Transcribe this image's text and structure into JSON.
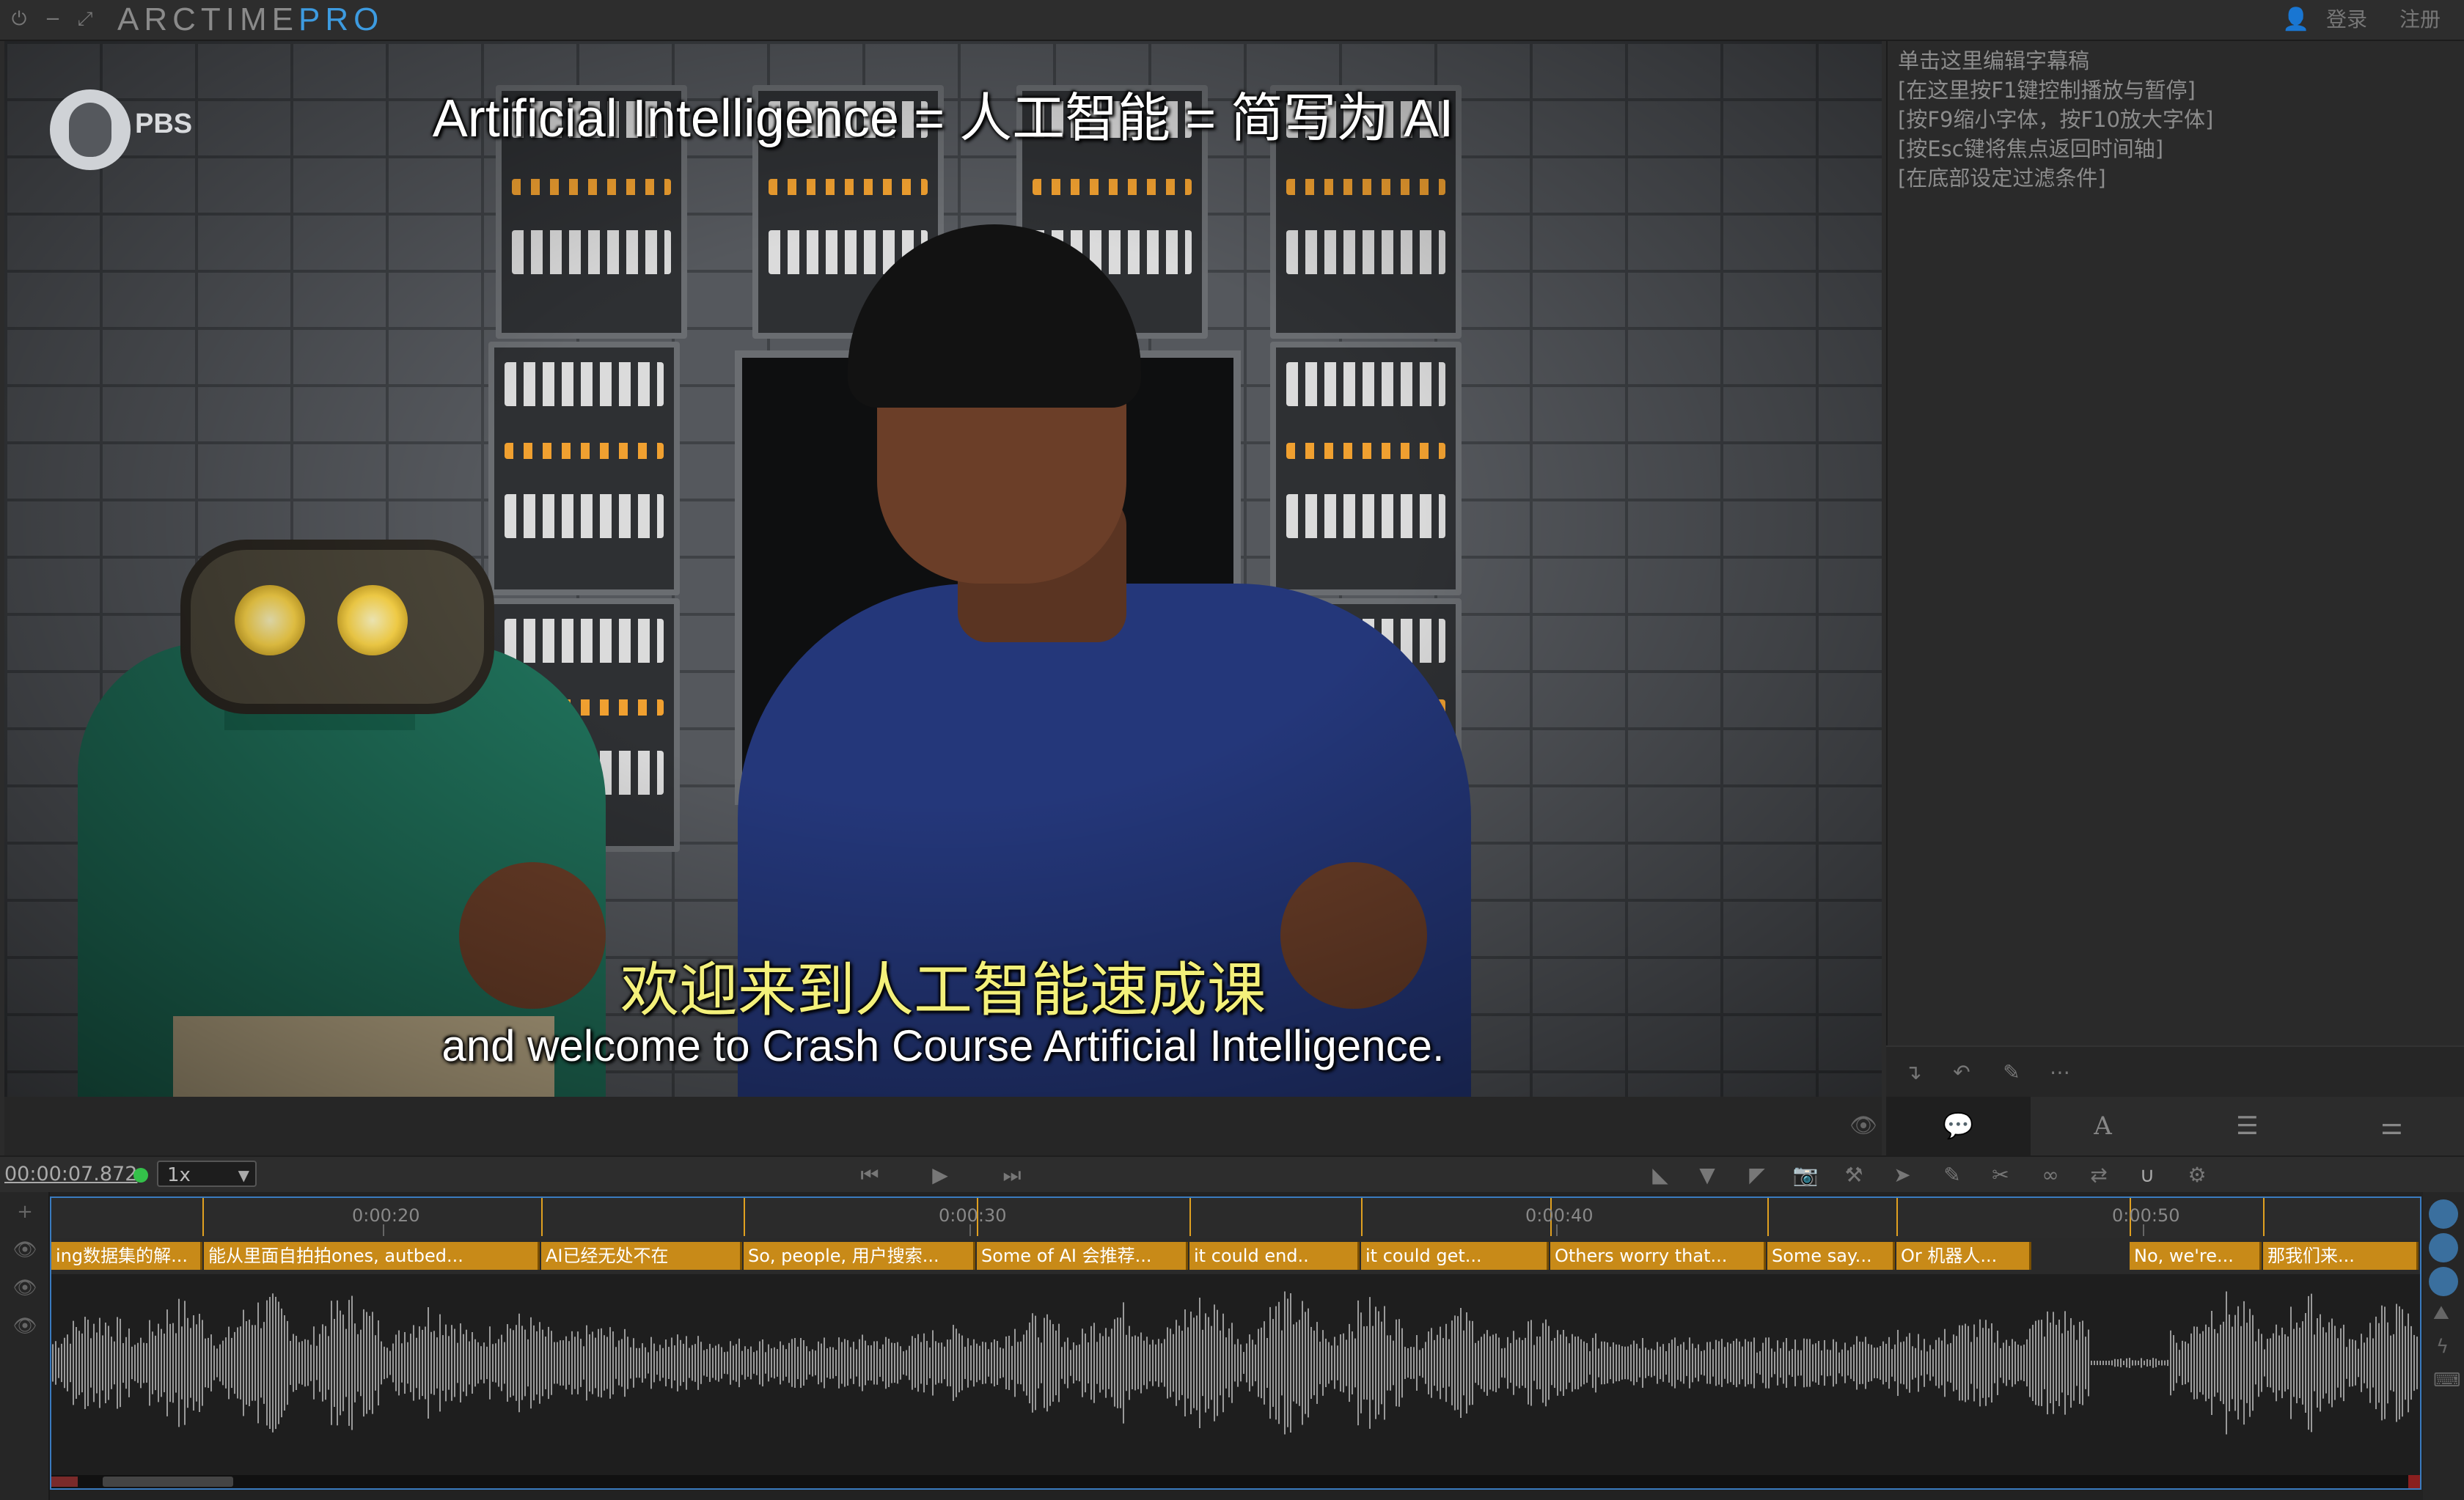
{
  "titlebar": {
    "app_name": "ARCTIME",
    "app_edition": "PRO",
    "login": "登录",
    "register": "注册"
  },
  "video": {
    "subtitle_top": "Artificial Intelligence = 人工智能 = 简写为 AI",
    "subtitle_cn": "欢迎来到人工智能速成课",
    "subtitle_en": "and welcome to Crash Course Artificial Intelligence.",
    "logo_text": "PBS"
  },
  "editor_hints": [
    "单击这里编辑字幕稿",
    "[在这里按F1键控制播放与暂停]",
    "[按F9缩小字体，按F10放大字体]",
    "[按Esc键将焦点返回时间轴]",
    "[在底部设定过滤条件]"
  ],
  "transport": {
    "timecode": "00:00:07.872",
    "speed": "1x"
  },
  "timeline": {
    "ruler_labels": [
      "0:00:20",
      "0:00:30",
      "0:00:40",
      "0:00:50"
    ],
    "segments": [
      "ing数据集的解...",
      "能从里面自拍拍ones, autbed...",
      "AI已经无处不在",
      "So, people, 用户搜索...",
      "Some of AI 会推荐...",
      "it could end..",
      "it could get...",
      "Others worry that...",
      "Some say...",
      "Or 机器人...",
      "No, we're...",
      "那我们来..."
    ]
  },
  "colors": {
    "accent": "#3d9be0",
    "segment": "#c88a18",
    "timeline_border": "#3a7bbf",
    "status_green": "#34c04a",
    "subtitle_cn": "#f3f07a"
  }
}
